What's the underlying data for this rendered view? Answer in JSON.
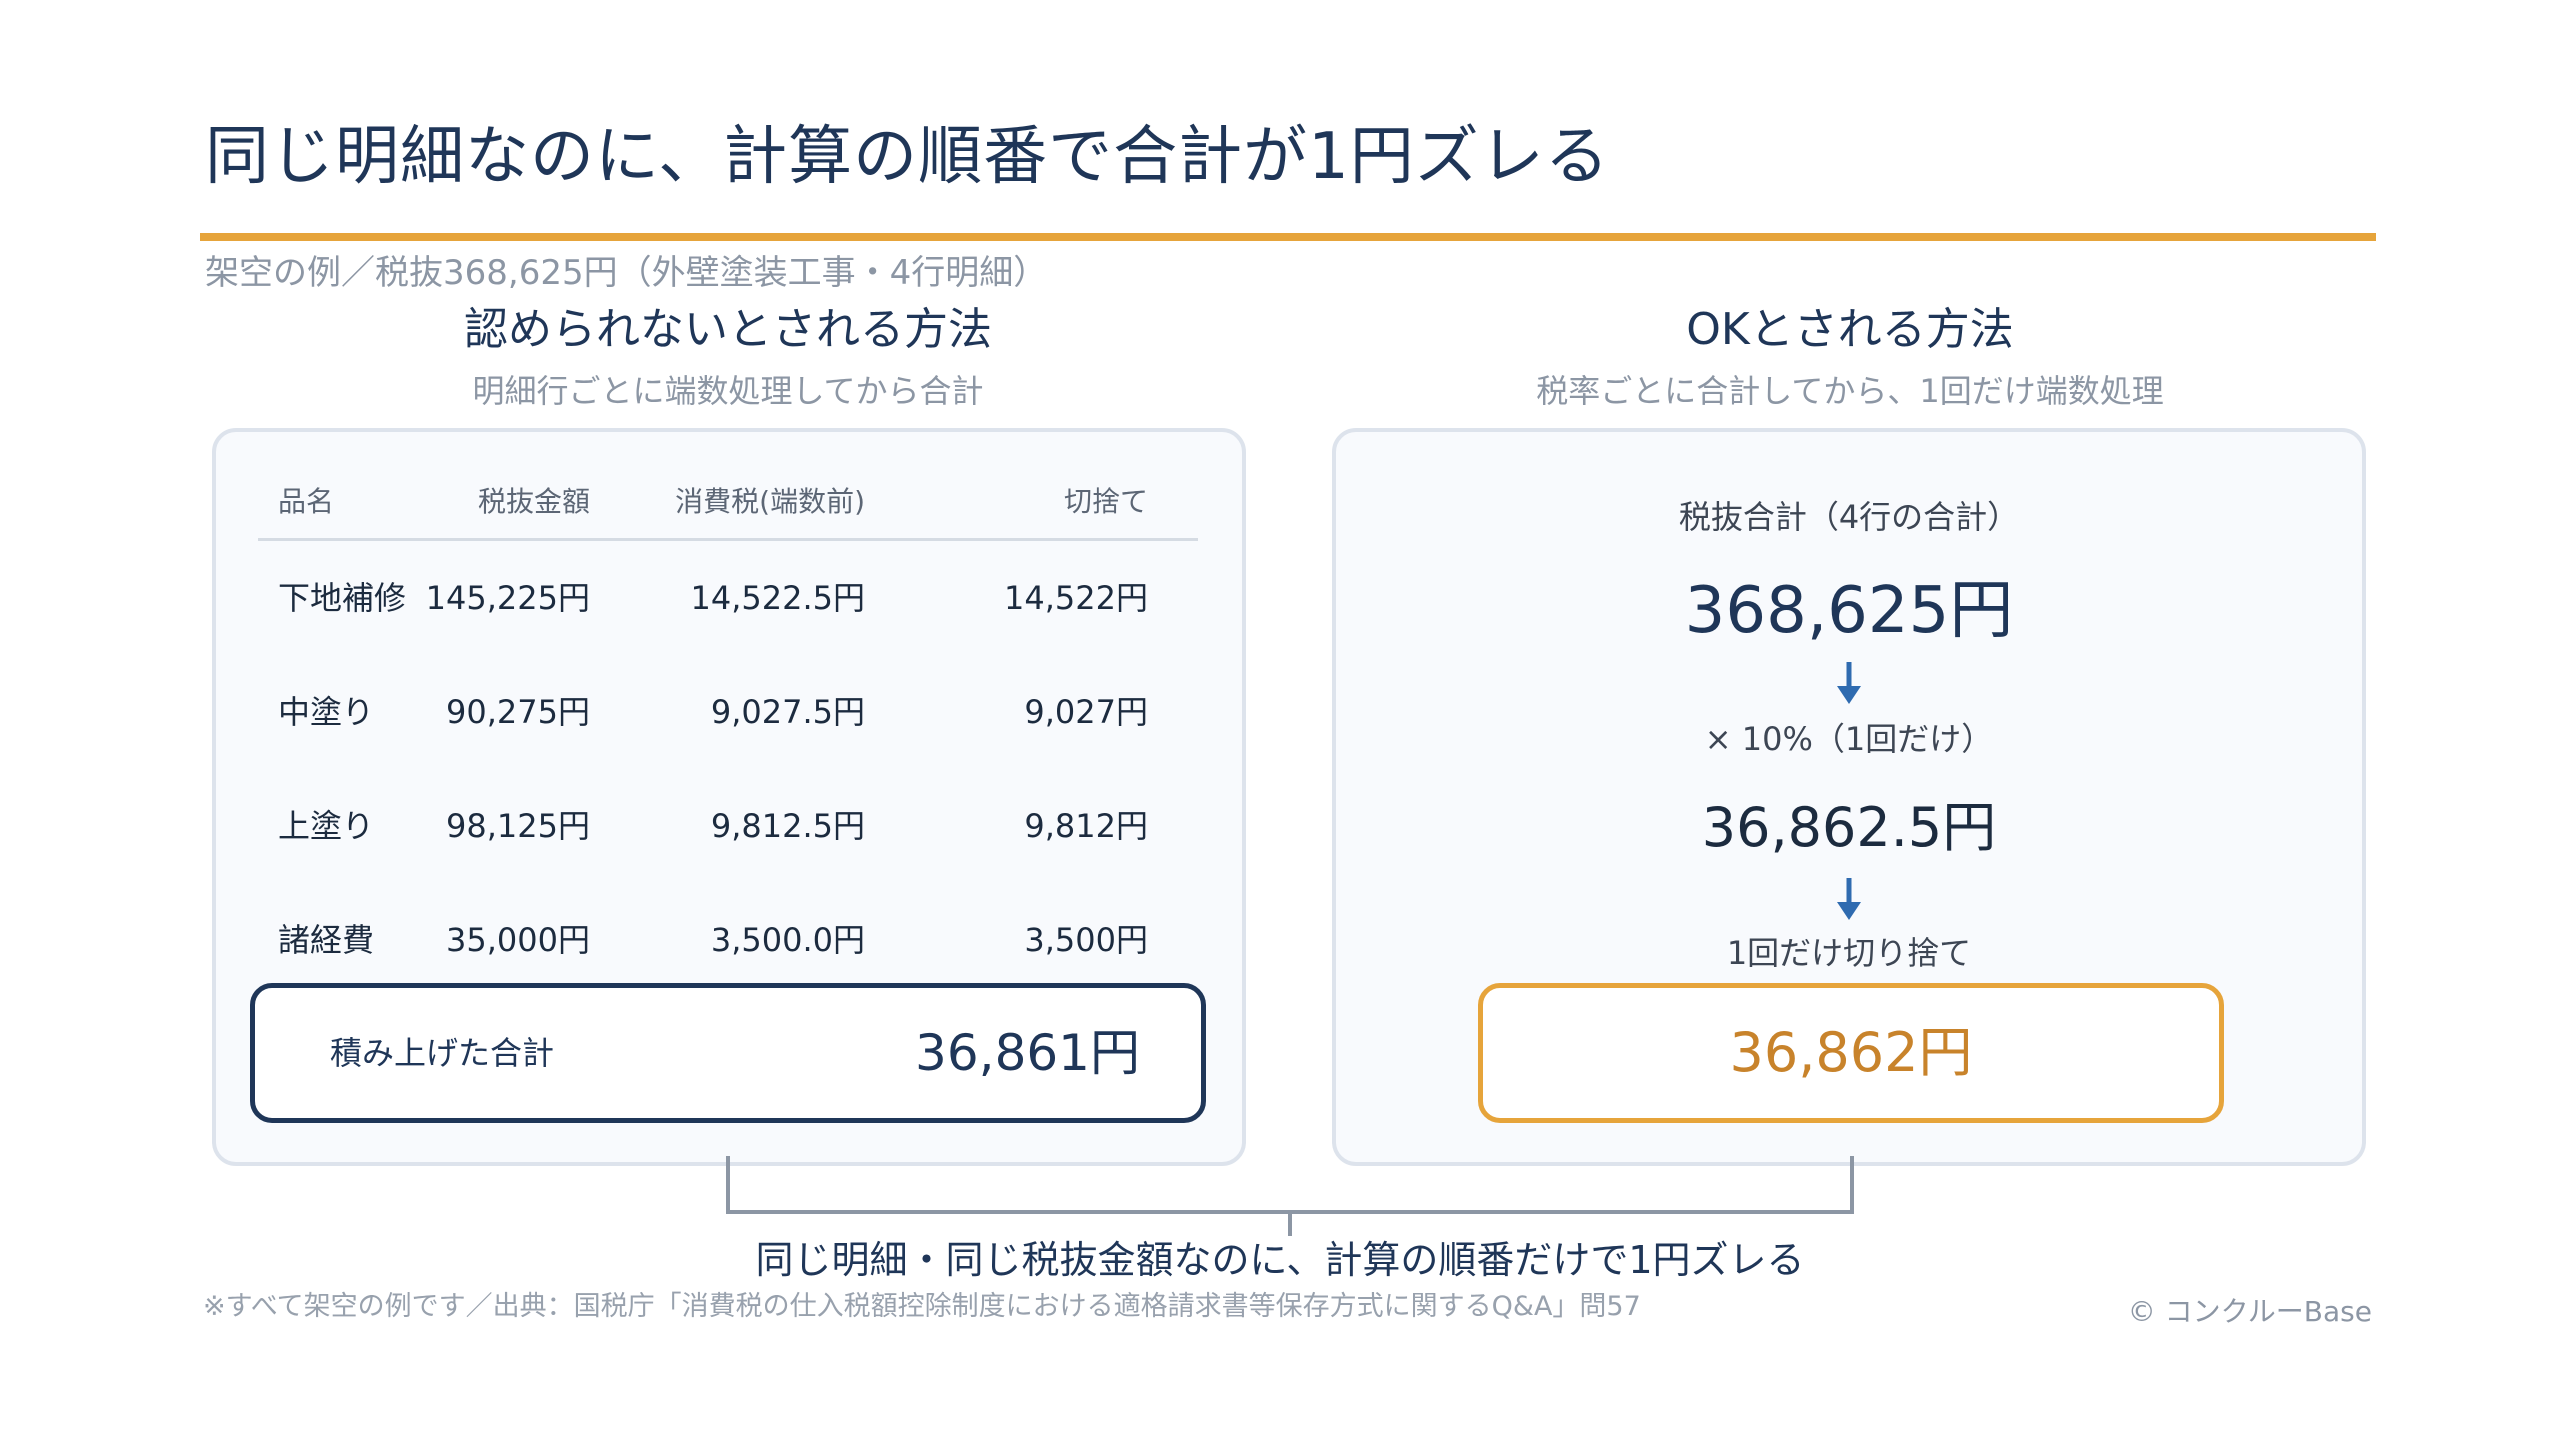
{
  "title": "同じ明細なのに、計算の順番で合計が1円ズレる",
  "subtitle": "架空の例／税抜368,625円（外壁塗装工事・4行明細）",
  "left": {
    "heading": "認められないとされる方法",
    "subheading": "明細行ごとに端数処理してから合計",
    "columns": [
      "品名",
      "税抜金額",
      "消費税(端数前)",
      "切捨て"
    ],
    "rows": [
      [
        "下地補修",
        "145,225円",
        "14,522.5円",
        "14,522円"
      ],
      [
        "中塗り",
        "90,275円",
        "9,027.5円",
        "9,027円"
      ],
      [
        "上塗り",
        "98,125円",
        "9,812.5円",
        "9,812円"
      ],
      [
        "諸経費",
        "35,000円",
        "3,500.0円",
        "3,500円"
      ]
    ],
    "total_label": "積み上げた合計",
    "total_value": "36,861円"
  },
  "right": {
    "heading": "OKとされる方法",
    "subheading": "税率ごとに合計してから、1回だけ端数処理",
    "base_label": "税抜合計（4行の合計）",
    "base_value": "368,625円",
    "rate_label": "× 10%（1回だけ）",
    "tax_value": "36,862.5円",
    "round_label": "1回だけ切り捨て",
    "total_value": "36,862円"
  },
  "conclusion": "同じ明細・同じ税抜金額なのに、計算の順番だけで1円ズレる",
  "footnote": "※すべて架空の例です／出典：国税庁「消費税の仕入税額控除制度における適格請求書等保存方式に関するQ&A」問57",
  "copyright": "© コンクルーBase",
  "colors": {
    "navy": "#1f3658",
    "accent": "#e6a43b",
    "arrow": "#2f6bb0",
    "muted": "#8c96a4"
  },
  "icons": [
    "arrow-down-icon",
    "bracket-connector"
  ]
}
